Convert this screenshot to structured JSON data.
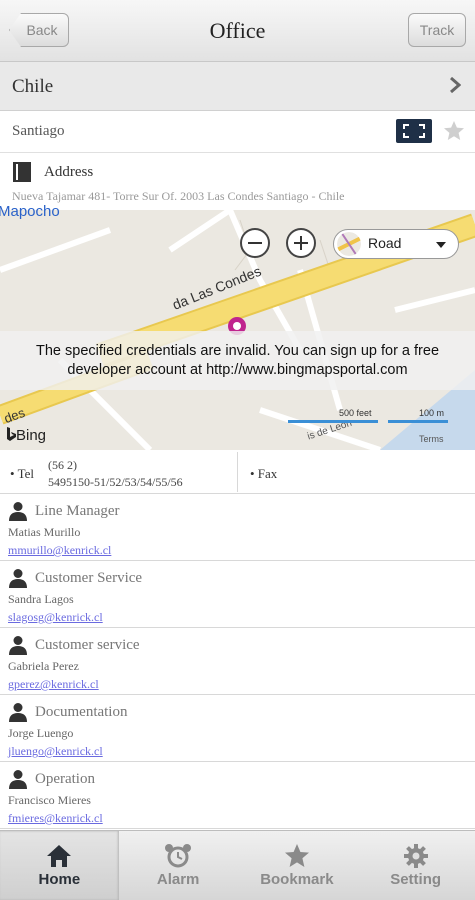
{
  "navbar": {
    "title": "Office",
    "back_label": "Back",
    "track_label": "Track"
  },
  "country": {
    "label": "Chile"
  },
  "city": {
    "label": "Santiago"
  },
  "address": {
    "title": "Address",
    "text": "Nueva Tajamar 481- Torre Sur Of. 2003  Las Condes Santiago - Chile"
  },
  "map": {
    "city_label": "Mapocho",
    "street_label_1": "da Las Condes",
    "street_label_2": "des",
    "street_label_3": "is de Leon",
    "view_mode": "Road",
    "error_message_line1": "The specified credentials are invalid. You can sign up for a free",
    "error_message_line2": "developer account at http://www.bingmapsportal.com",
    "logo": "Bing",
    "scale_feet": "500 feet",
    "scale_m": "100 m",
    "terms": "Terms"
  },
  "contact": {
    "tel_label": "• Tel",
    "tel_line1": "(56 2)",
    "tel_line2": "5495150-51/52/53/54/55/56",
    "fax_label": "• Fax"
  },
  "staff": [
    {
      "role": "Line Manager",
      "name": "Matias Murillo",
      "email": "mmurillo@kenrick.cl"
    },
    {
      "role": "Customer Service",
      "name": "Sandra Lagos",
      "email": "slagosg@kenrick.cl"
    },
    {
      "role": "Customer service",
      "name": "Gabriela Perez",
      "email": "gperez@kenrick.cl"
    },
    {
      "role": "Documentation",
      "name": "Jorge Luengo",
      "email": "jluengo@kenrick.cl"
    },
    {
      "role": "Operation",
      "name": "Francisco Mieres",
      "email": "fmieres@kenrick.cl"
    }
  ],
  "tabs": [
    {
      "label": "Home",
      "icon": "home-icon",
      "active": true
    },
    {
      "label": "Alarm",
      "icon": "alarm-clock-icon",
      "active": false
    },
    {
      "label": "Bookmark",
      "icon": "star-icon",
      "active": false
    },
    {
      "label": "Setting",
      "icon": "gear-icon",
      "active": false
    }
  ],
  "colors": {
    "accent_link": "#6a6ae0",
    "map_road": "#f4d76a",
    "map_water": "#a7c6e8",
    "pin": "#c0248e",
    "scale_bar": "#3a8fd6"
  }
}
